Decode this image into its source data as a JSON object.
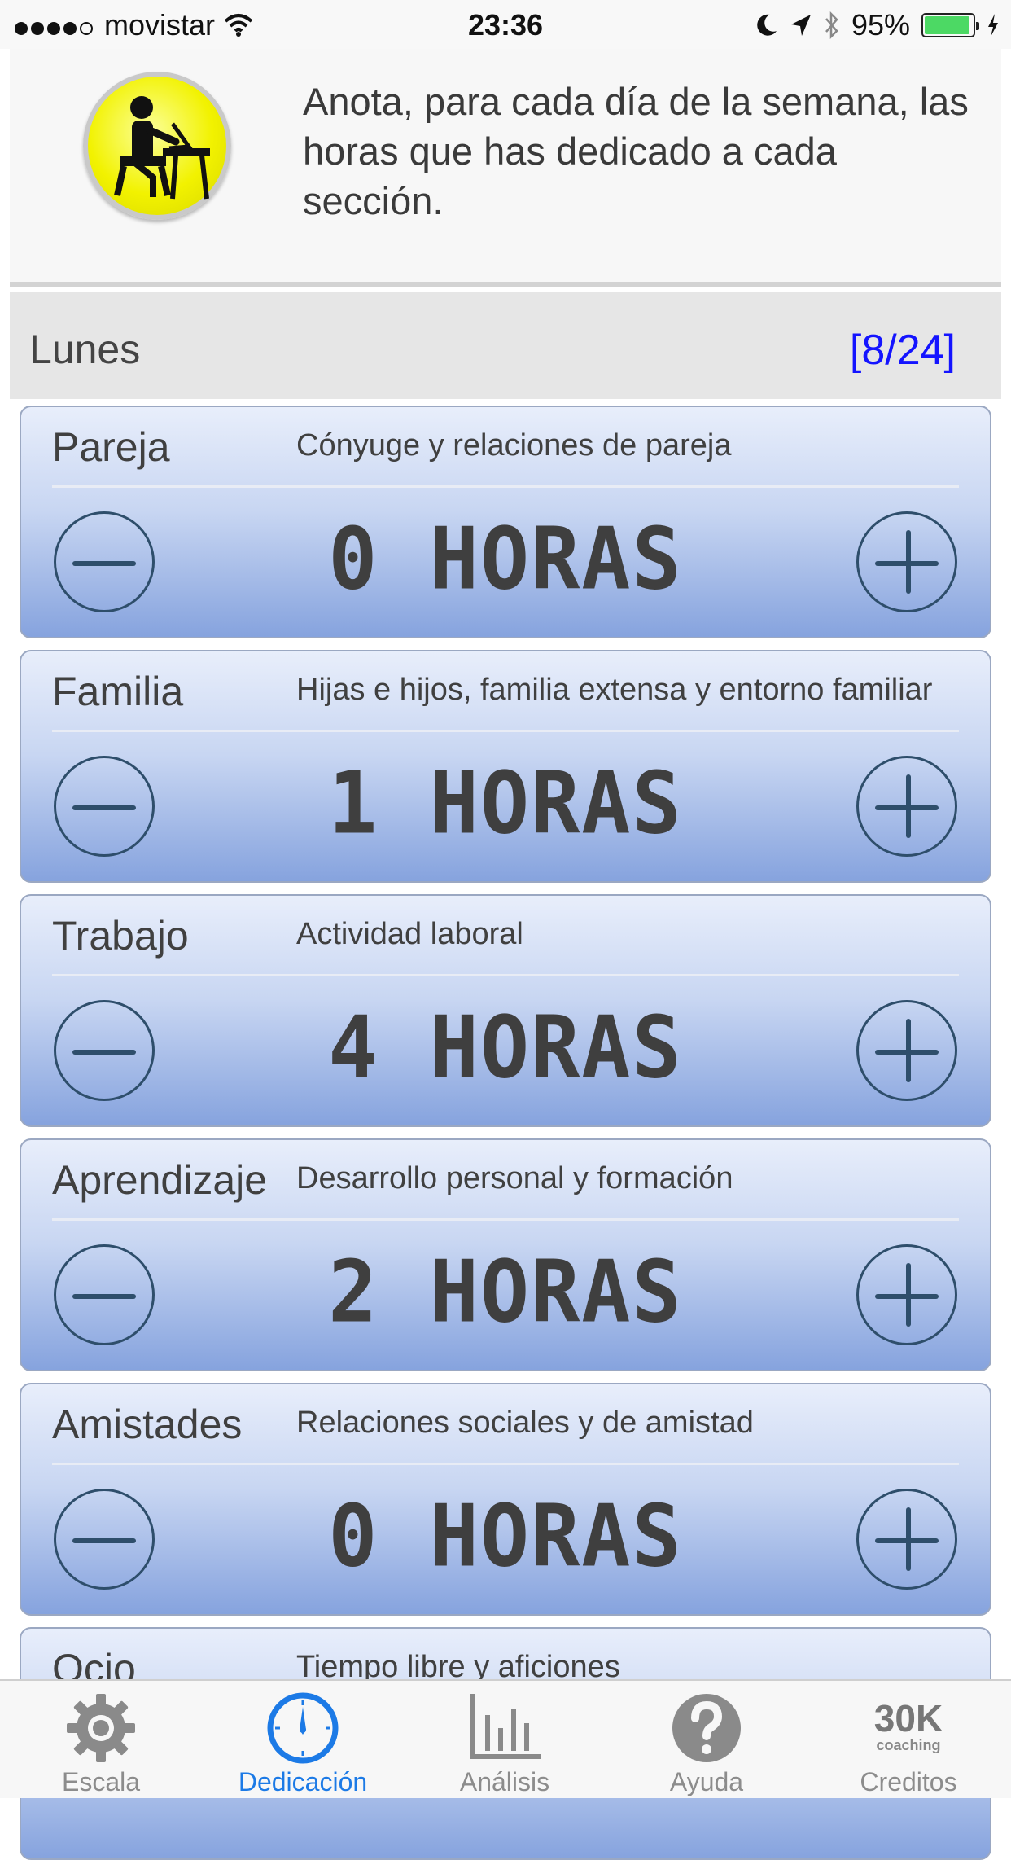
{
  "status_bar": {
    "carrier": "movistar",
    "time": "23:36",
    "battery_percent": "95%",
    "battery_level": 0.95
  },
  "header": {
    "text": "Anota, para cada día de la semana, las horas que has dedicado a cada sección."
  },
  "day": {
    "name": "Lunes",
    "counter": "[8/24]"
  },
  "sections": [
    {
      "title": "Pareja",
      "description": "Cónyuge y relaciones de pareja",
      "hours": "0 HORAS"
    },
    {
      "title": "Familia",
      "description": "Hijas e hijos, familia extensa y entorno familiar",
      "hours": "1 HORAS"
    },
    {
      "title": "Trabajo",
      "description": "Actividad laboral",
      "hours": "4 HORAS"
    },
    {
      "title": "Aprendizaje",
      "description": "Desarrollo personal y formación",
      "hours": "2 HORAS"
    },
    {
      "title": "Amistades",
      "description": "Relaciones sociales y de amistad",
      "hours": "0 HORAS"
    },
    {
      "title": "Ocio",
      "description": "Tiempo libre y aficiones",
      "hours": ""
    }
  ],
  "tab_bar": {
    "tabs": [
      {
        "label": "Escala",
        "icon": "gear-icon"
      },
      {
        "label": "Dedicación",
        "icon": "clock-icon",
        "active": true
      },
      {
        "label": "Análisis",
        "icon": "bar-chart-icon"
      },
      {
        "label": "Ayuda",
        "icon": "question-icon"
      },
      {
        "label": "Creditos",
        "icon": "30k-logo-icon",
        "logo_text": "30K",
        "logo_subtext": "coaching"
      }
    ]
  },
  "colors": {
    "accent": "#1c7ae6",
    "counter": "#1414ff",
    "battery": "#4cd964",
    "avatar_yellow": "#f2f200"
  }
}
